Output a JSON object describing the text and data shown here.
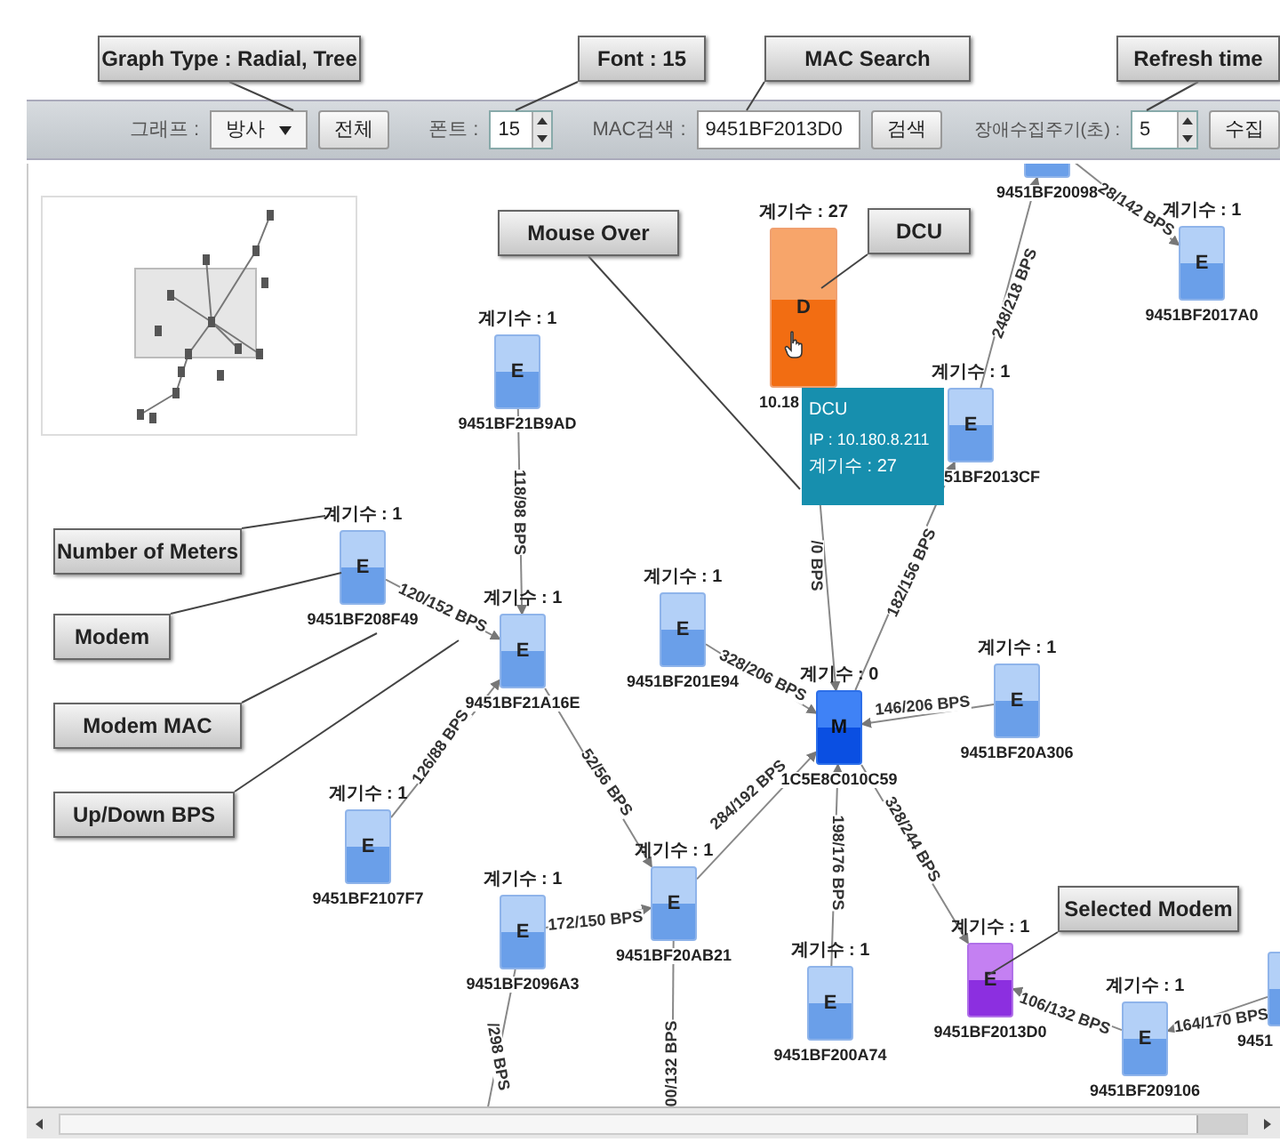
{
  "callouts": [
    {
      "text": "Graph Type : Radial, Tree"
    },
    {
      "text": "Font : 15"
    },
    {
      "text": "MAC Search"
    },
    {
      "text": "Refresh time"
    },
    {
      "text": "Mouse Over"
    },
    {
      "text": "DCU"
    },
    {
      "text": "Number of Meters"
    },
    {
      "text": "Modem"
    },
    {
      "text": "Modem MAC"
    },
    {
      "text": "Up/Down BPS"
    },
    {
      "text": "Selected Modem"
    }
  ],
  "toolbar": {
    "graph_label": "그래프 :",
    "graph_type": "방사",
    "all_button": "전체",
    "font_label": "폰트 :",
    "font_size": "15",
    "mac_label": "MAC검색 :",
    "mac_value": "9451BF2013D0",
    "search_button": "검색",
    "interval_label": "장애수집주기(초) :",
    "interval": "5",
    "collect_button": "수집"
  },
  "nodes": [
    {
      "kind": "meter",
      "selected": false,
      "label": "9451BF20098"
    },
    {
      "kind": "dcu",
      "selected": false,
      "count": "계기수 : 27",
      "letter": "D",
      "label": "10.18"
    },
    {
      "kind": "meter",
      "selected": false,
      "count": "계기수 : 1",
      "letter": "E",
      "label": "9451BF2017A0"
    },
    {
      "kind": "meter",
      "selected": false,
      "count": "계기수 : 1",
      "letter": "E",
      "label": "9451BF21B9AD"
    },
    {
      "kind": "meter",
      "selected": false,
      "count": "계기수 : 1",
      "letter": "E",
      "label": "51BF2013CF"
    },
    {
      "kind": "meter",
      "selected": false,
      "count": "계기수 : 1",
      "letter": "E",
      "label": "9451BF208F49"
    },
    {
      "kind": "meter",
      "selected": false,
      "count": "계기수 : 1",
      "letter": "E",
      "label": "9451BF21A16E"
    },
    {
      "kind": "meter",
      "selected": false,
      "count": "계기수 : 1",
      "letter": "E",
      "label": "9451BF201E94"
    },
    {
      "kind": "modem",
      "selected": false,
      "count": "계기수 : 0",
      "letter": "M",
      "label": "1C5E8C010C59"
    },
    {
      "kind": "meter",
      "selected": false,
      "count": "계기수 : 1",
      "letter": "E",
      "label": "9451BF20A306"
    },
    {
      "kind": "meter",
      "selected": false,
      "count": "계기수 : 1",
      "letter": "E",
      "label": "9451BF2107F7"
    },
    {
      "kind": "meter",
      "selected": false,
      "count": "계기수 : 1",
      "letter": "E",
      "label": "9451BF20AB21"
    },
    {
      "kind": "meter",
      "selected": false,
      "count": "계기수 : 1",
      "letter": "E",
      "label": "9451BF2096A3"
    },
    {
      "kind": "meter",
      "selected": false,
      "count": "계기수 : 1",
      "letter": "E",
      "label": "9451BF200A74"
    },
    {
      "kind": "meter",
      "selected": true,
      "count": "계기수 : 1",
      "letter": "E",
      "label": "9451BF2013D0"
    },
    {
      "kind": "meter",
      "selected": false,
      "count": "계기수 : 1",
      "letter": "E",
      "label": "9451BF209106"
    },
    {
      "kind": "meter",
      "selected": false,
      "label": "9451"
    }
  ],
  "edges": [
    {
      "label": "28/142 BPS"
    },
    {
      "label": "248/218 BPS"
    },
    {
      "label": "/0 BPS"
    },
    {
      "label": "182/156 BPS"
    },
    {
      "label": "118/98 BPS"
    },
    {
      "label": "120/152 BPS"
    },
    {
      "label": "328/206 BPS"
    },
    {
      "label": "146/206 BPS"
    },
    {
      "label": "126/88 BPS"
    },
    {
      "label": "52/56 BPS"
    },
    {
      "label": "284/192 BPS"
    },
    {
      "label": "172/150 BPS"
    },
    {
      "label": "198/176 BPS"
    },
    {
      "label": "328/244 BPS"
    },
    {
      "label": "106/132 BPS"
    },
    {
      "label": "164/170 BPS"
    },
    {
      "label": "/298 BPS"
    },
    {
      "label": "00/132 BPS"
    }
  ],
  "tooltip": {
    "title": "DCU",
    "ip": "IP : 10.180.8.211",
    "count": "계기수 : 27"
  }
}
